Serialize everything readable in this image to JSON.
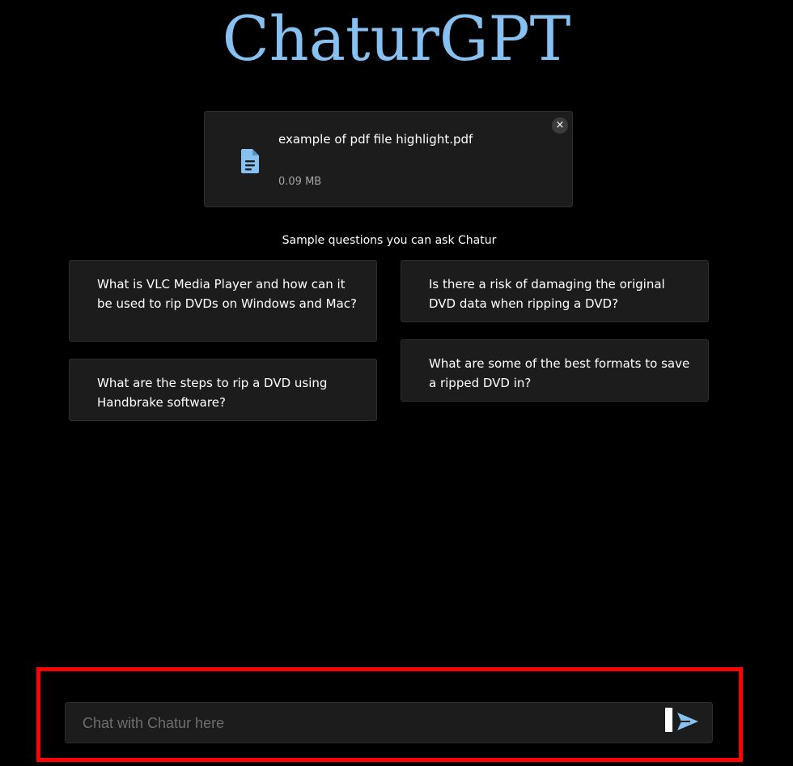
{
  "app": {
    "title": "ChaturGPT",
    "accent_color": "#86c1f2",
    "background_color": "#000000"
  },
  "file": {
    "name": "example of pdf file highlight.pdf",
    "size": "0.09 MB",
    "icon": "document-icon",
    "close_icon": "close-icon",
    "close_glyph": "×"
  },
  "samples": {
    "heading": "Sample questions you can ask Chatur",
    "questions": [
      "What is VLC Media Player and how can it be used to rip DVDs on Windows and Mac?",
      "Is there a risk of damaging the original DVD data when ripping a DVD?",
      "What are the steps to rip a DVD using Handbrake software?",
      "What are some of the best formats to save a ripped DVD in?"
    ]
  },
  "chat": {
    "placeholder": "Chat with Chatur here",
    "value": "",
    "send_icon": "send-icon"
  },
  "annotation": {
    "highlight_color": "#ff0000"
  }
}
